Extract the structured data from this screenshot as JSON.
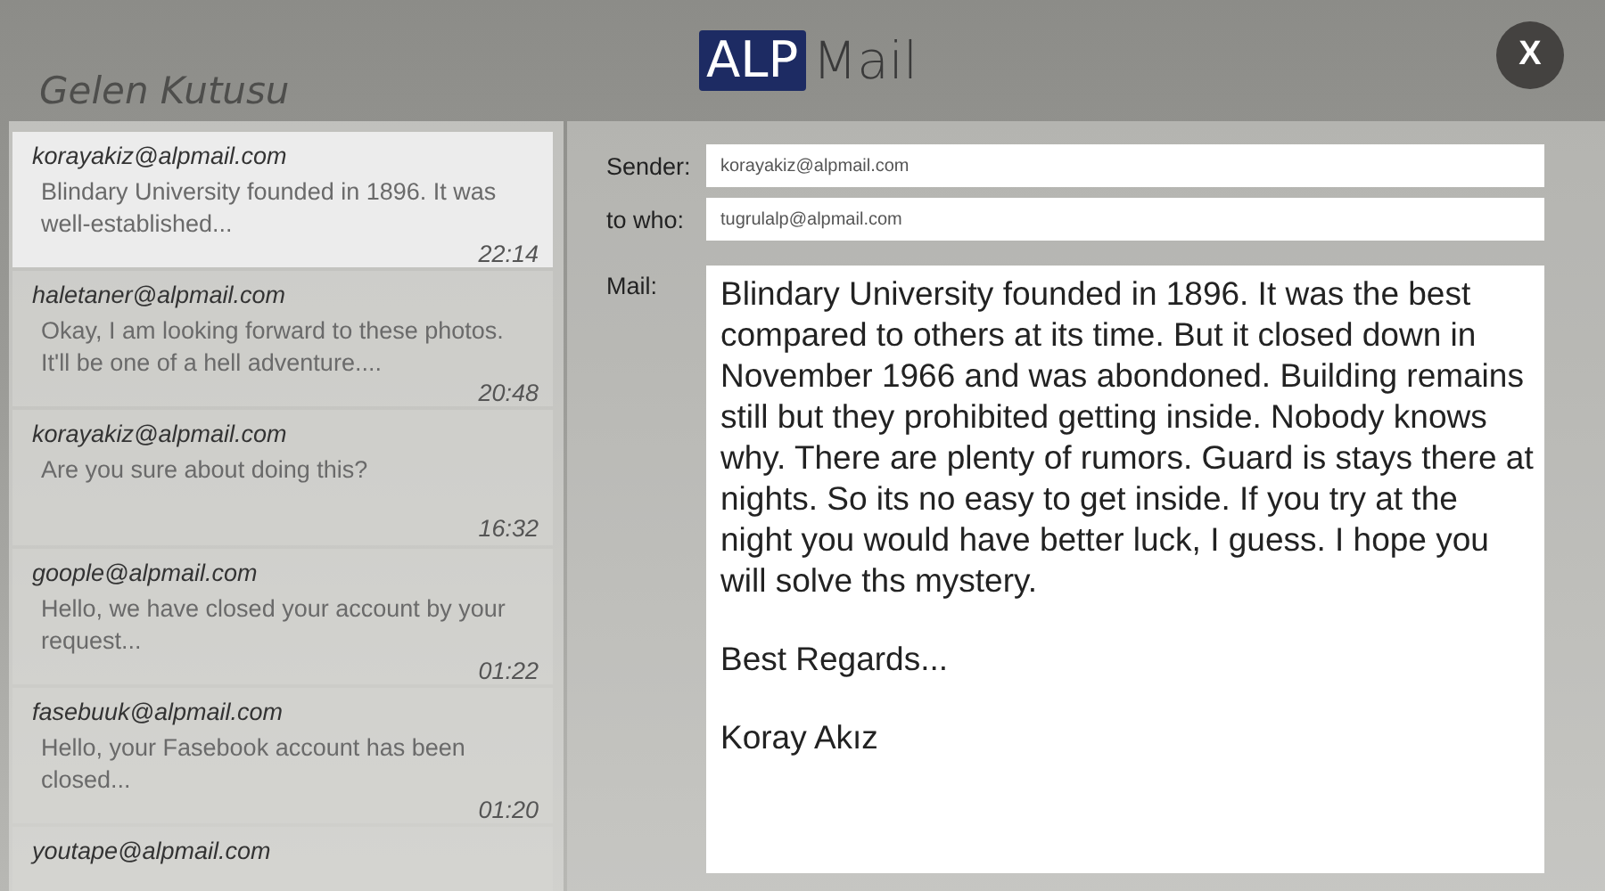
{
  "inbox": {
    "title": "Gelen Kutusu",
    "messages": [
      {
        "sender": "korayakiz@alpmail.com",
        "preview": "Blindary University founded in 1896. It was well-established...",
        "time": "22:14",
        "selected": true
      },
      {
        "sender": "haletaner@alpmail.com",
        "preview": "Okay, I am looking forward to these photos. It'll be one of a hell adventure....",
        "time": "20:48",
        "selected": false
      },
      {
        "sender": "korayakiz@alpmail.com",
        "preview": "Are you sure about doing this?",
        "time": "16:32",
        "selected": false
      },
      {
        "sender": "goople@alpmail.com",
        "preview": "Hello, we have closed your account by your request...",
        "time": "01:22",
        "selected": false
      },
      {
        "sender": "fasebuuk@alpmail.com",
        "preview": "Hello, your Fasebook account has been closed...",
        "time": "01:20",
        "selected": false
      },
      {
        "sender": "youtape@alpmail.com",
        "selected": false
      }
    ]
  },
  "logo": {
    "badge": "ALP",
    "name": "Mail"
  },
  "close_button": {
    "label": "X"
  },
  "message": {
    "sender_label": "Sender:",
    "sender": "korayakiz@alpmail.com",
    "to_label": "to who:",
    "to": "tugrulalp@alpmail.com",
    "mail_label": "Mail:",
    "paragraphs": [
      "Blindary University founded in 1896. It was the best compared to others at its time. But it closed down in November 1966 and was abondoned. Building remains still but they prohibited getting inside. Nobody knows why. There are plenty of rumors. Guard is stays there at nights. So its no easy to get inside. If you try at the night you would have better luck, I guess. I hope you will solve ths mystery.",
      "Best Regards...",
      "Koray Akız"
    ]
  }
}
